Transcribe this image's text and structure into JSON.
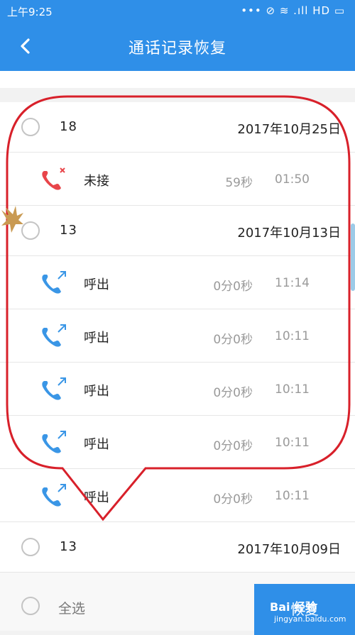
{
  "status_bar": {
    "time": "上午9:25",
    "icons_text": "••• ⊘ ≋ .ıll HD ▭"
  },
  "app_bar": {
    "title": "通话记录恢复"
  },
  "groups": [
    {
      "number": "18",
      "date": "2017年10月25日",
      "calls": [
        {
          "type": "未接",
          "duration": "59秒",
          "time": "01:50",
          "kind": "missed",
          "icon": "missed-call-icon"
        }
      ]
    },
    {
      "number": "13",
      "date": "2017年10月13日",
      "calls": [
        {
          "type": "呼出",
          "duration": "0分0秒",
          "time": "11:14",
          "kind": "outgoing",
          "icon": "outgoing-call-icon"
        },
        {
          "type": "呼出",
          "duration": "0分0秒",
          "time": "10:11",
          "kind": "outgoing",
          "icon": "outgoing-call-icon"
        },
        {
          "type": "呼出",
          "duration": "0分0秒",
          "time": "10:11",
          "kind": "outgoing",
          "icon": "outgoing-call-icon"
        },
        {
          "type": "呼出",
          "duration": "0分0秒",
          "time": "10:11",
          "kind": "outgoing",
          "icon": "outgoing-call-icon"
        },
        {
          "type": "呼出",
          "duration": "0分0秒",
          "time": "10:11",
          "kind": "outgoing",
          "icon": "outgoing-call-icon"
        }
      ]
    },
    {
      "number": "13",
      "date": "2017年10月09日",
      "calls": []
    }
  ],
  "bottom_bar": {
    "select_all": "全选",
    "restore_button": "恢复"
  },
  "watermark": {
    "brand": "Bai 经验",
    "url": "jingyan.baidu.com"
  },
  "colors": {
    "primary": "#2f8fe8",
    "missed": "#e8454a",
    "outgoing": "#3a96e6",
    "annotation": "#d8202a"
  }
}
